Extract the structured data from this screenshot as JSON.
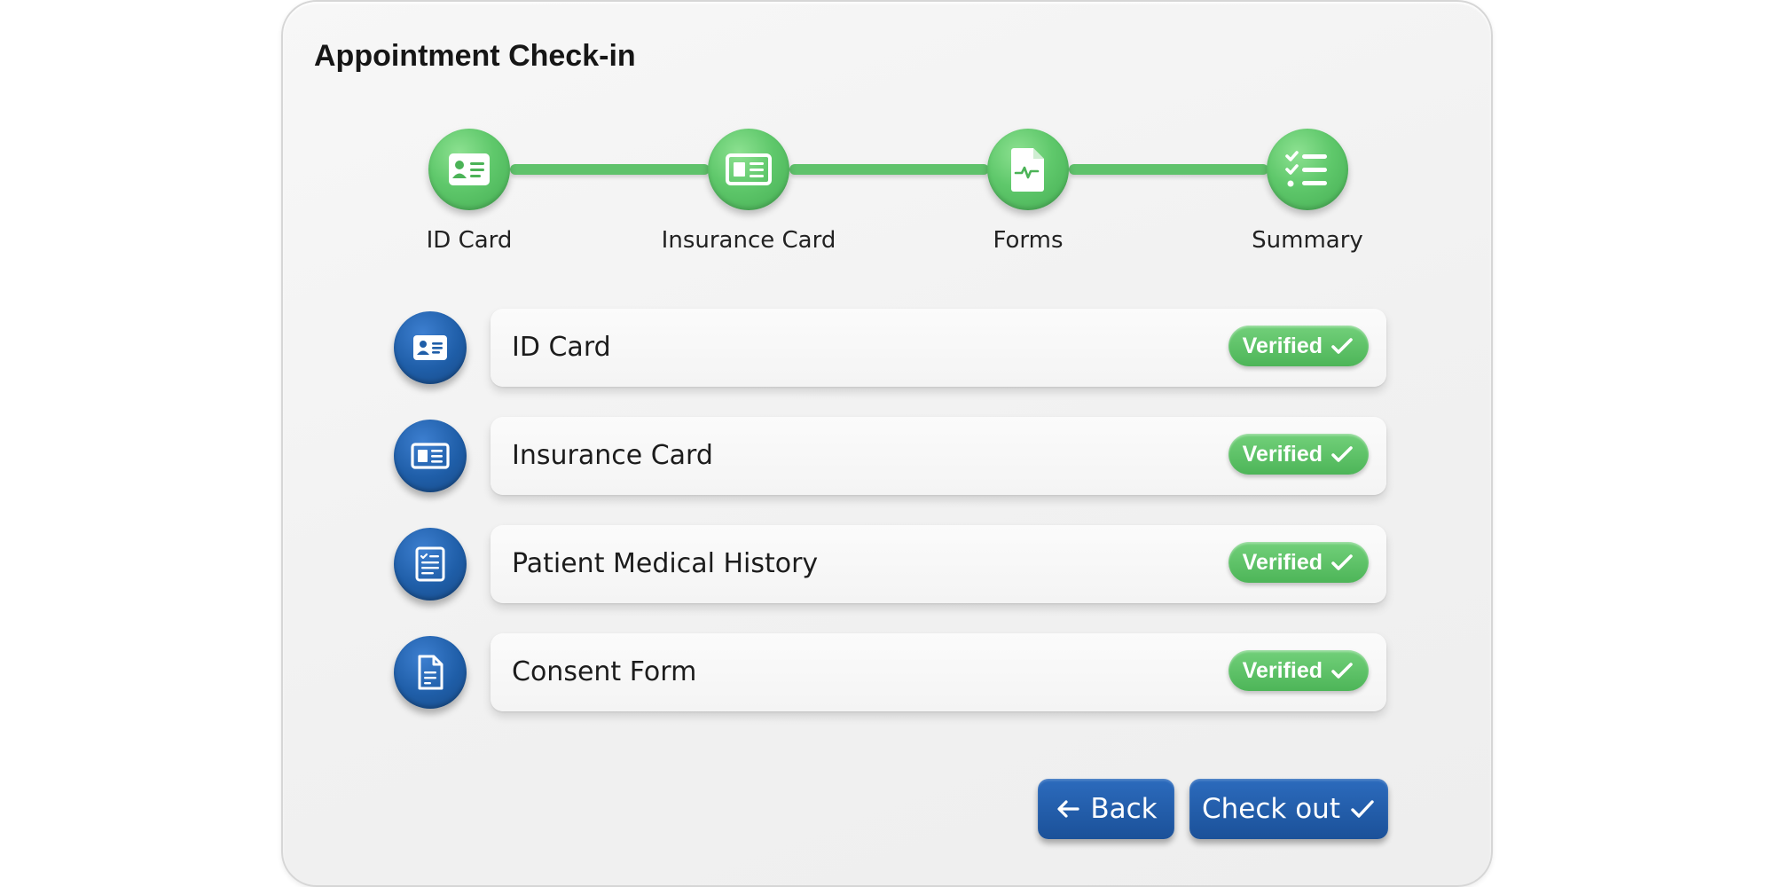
{
  "page": {
    "title": "Appointment Check-in"
  },
  "stepper": {
    "steps": [
      {
        "label": "ID Card",
        "icon": "id-card-icon"
      },
      {
        "label": "Insurance Card",
        "icon": "insurance-card-icon"
      },
      {
        "label": "Forms",
        "icon": "form-document-icon"
      },
      {
        "label": "Summary",
        "icon": "checklist-icon"
      }
    ],
    "color": "#5fc26b"
  },
  "items": [
    {
      "label": "ID Card",
      "status": "Verified",
      "icon": "id-card-icon"
    },
    {
      "label": "Insurance Card",
      "status": "Verified",
      "icon": "insurance-card-icon"
    },
    {
      "label": "Patient Medical History",
      "status": "Verified",
      "icon": "medical-history-icon"
    },
    {
      "label": "Consent Form",
      "status": "Verified",
      "icon": "document-icon"
    }
  ],
  "actions": {
    "back_label": "Back",
    "checkout_label": "Check out"
  },
  "colors": {
    "accent_green": "#5fc26b",
    "accent_blue": "#1f5ea8"
  }
}
